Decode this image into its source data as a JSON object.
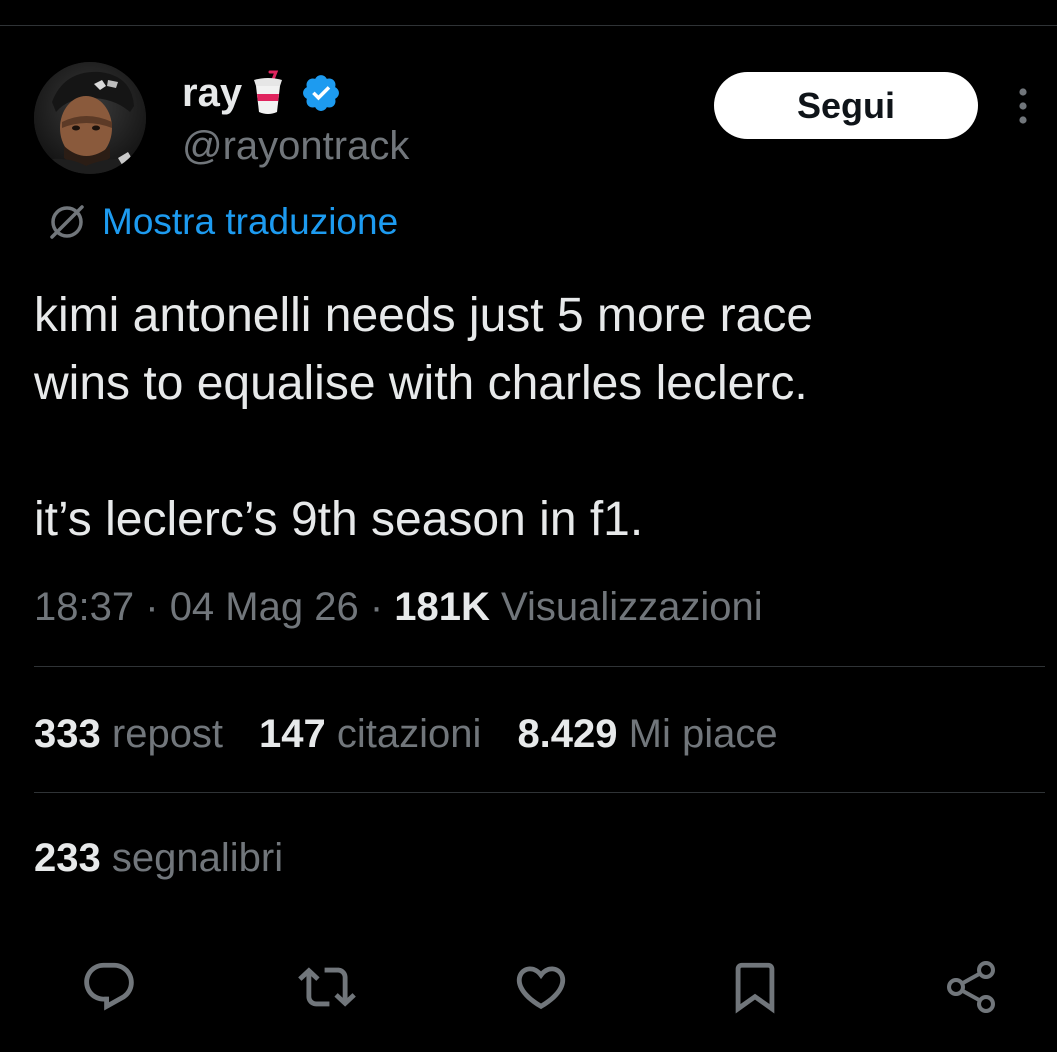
{
  "author": {
    "display_name": "ray",
    "handle": "@rayontrack",
    "emoji_icon": "cup-with-straw-icon",
    "verified_icon": "verified-badge-icon",
    "verified_color": "#1d9bf0"
  },
  "header": {
    "follow_label": "Segui",
    "more_icon": "more-vertical-icon"
  },
  "translate": {
    "label": "Mostra traduzione",
    "icon": "translate-icon",
    "color": "#1d9bf0"
  },
  "tweet": {
    "line1": "kimi antonelli needs just 5 more race",
    "line2": "wins to equalise with charles leclerc.",
    "line3": "it’s leclerc’s 9th season in f1."
  },
  "meta": {
    "time": "18:37",
    "separator": "·",
    "date": "04 Mag 26",
    "views_count": "181K",
    "views_label": "Visualizzazioni"
  },
  "stats": {
    "reposts_count": "333",
    "reposts_label": "repost",
    "quotes_count": "147",
    "quotes_label": "citazioni",
    "likes_count": "8.429",
    "likes_label": "Mi piace",
    "bookmarks_count": "233",
    "bookmarks_label": "segnalibri"
  },
  "actions": [
    "reply-icon",
    "repost-icon",
    "like-icon",
    "bookmark-icon",
    "share-icon"
  ],
  "colors": {
    "background": "#000000",
    "text_primary": "#e7e9ea",
    "text_secondary": "#71767b",
    "divider": "#2f3336",
    "accent": "#1d9bf0"
  }
}
